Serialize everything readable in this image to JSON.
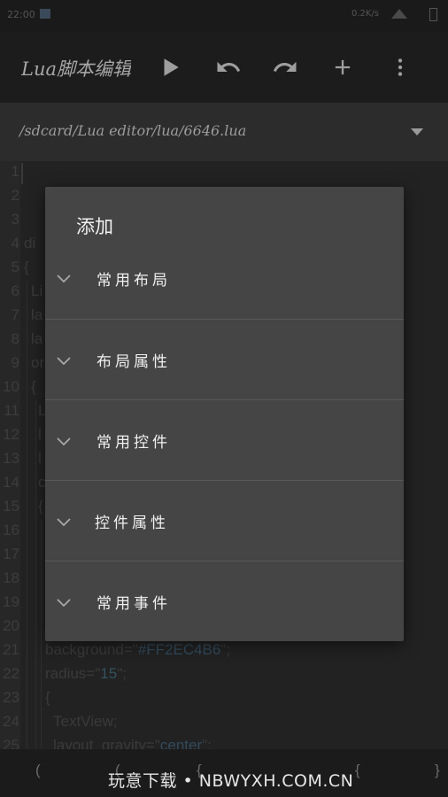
{
  "status_bar": {
    "time": "22:00",
    "network": "0.2K/s"
  },
  "app_bar": {
    "title": "Lua脚本编辑",
    "actions": [
      {
        "name": "run",
        "icon": "play-icon"
      },
      {
        "name": "undo",
        "icon": "undo-icon"
      },
      {
        "name": "redo",
        "icon": "redo-icon"
      },
      {
        "name": "add",
        "icon": "plus-icon"
      },
      {
        "name": "more",
        "icon": "more-vert-icon"
      }
    ]
  },
  "path_bar": {
    "path": "/sdcard/Lua editor/lua/6646.lua",
    "dropdown_icon": "arrow-drop-down-icon"
  },
  "editor": {
    "line_numbers": [
      "1",
      "2",
      "3",
      "4",
      "5",
      "6",
      "7",
      "8",
      "9",
      "10",
      "11",
      "12",
      "13",
      "14",
      "15",
      "16",
      "17",
      "18",
      "19",
      "20",
      "21",
      "22",
      "23",
      "24",
      "25"
    ],
    "code_lines": [
      {
        "text": "di"
      },
      {
        "text": "{"
      },
      {
        "text": "Li"
      },
      {
        "text": "la"
      },
      {
        "text": "la"
      },
      {
        "text": "or"
      },
      {
        "text": "{"
      },
      {
        "text": "L"
      },
      {
        "text": "l"
      },
      {
        "text": "l"
      },
      {
        "text": "c"
      },
      {
        "text": "{"
      },
      {
        "text": "background=\"",
        "value": "#FF2EC4B6",
        "tail": "\";"
      },
      {
        "text": "radius=\"",
        "value": "15",
        "tail": "\";"
      },
      {
        "text": "{"
      },
      {
        "text": "TextView;"
      },
      {
        "text": "layout_gravity=\"",
        "value": "center",
        "tail": "\";"
      }
    ]
  },
  "dialog": {
    "title": "添加",
    "groups": [
      {
        "label": "常用布局",
        "icon": "chevron-down-icon"
      },
      {
        "label": "布局属性",
        "icon": "chevron-down-icon"
      },
      {
        "label": "常用控件",
        "icon": "chevron-down-icon"
      },
      {
        "label": "控件属性",
        "icon": "chevron-down-icon"
      },
      {
        "label": "常用事件",
        "icon": "chevron-down-icon"
      }
    ]
  },
  "bottom_bar": {
    "symbols": [
      "(",
      "(",
      "{",
      "{",
      "}"
    ]
  },
  "watermark": "玩意下载 • NBWYXH.COM.CN",
  "colors": {
    "dialog_background": "#454545",
    "app_bar_background": "#1c1c1c",
    "editor_background": "#222222",
    "string_value": "#324a5c"
  }
}
